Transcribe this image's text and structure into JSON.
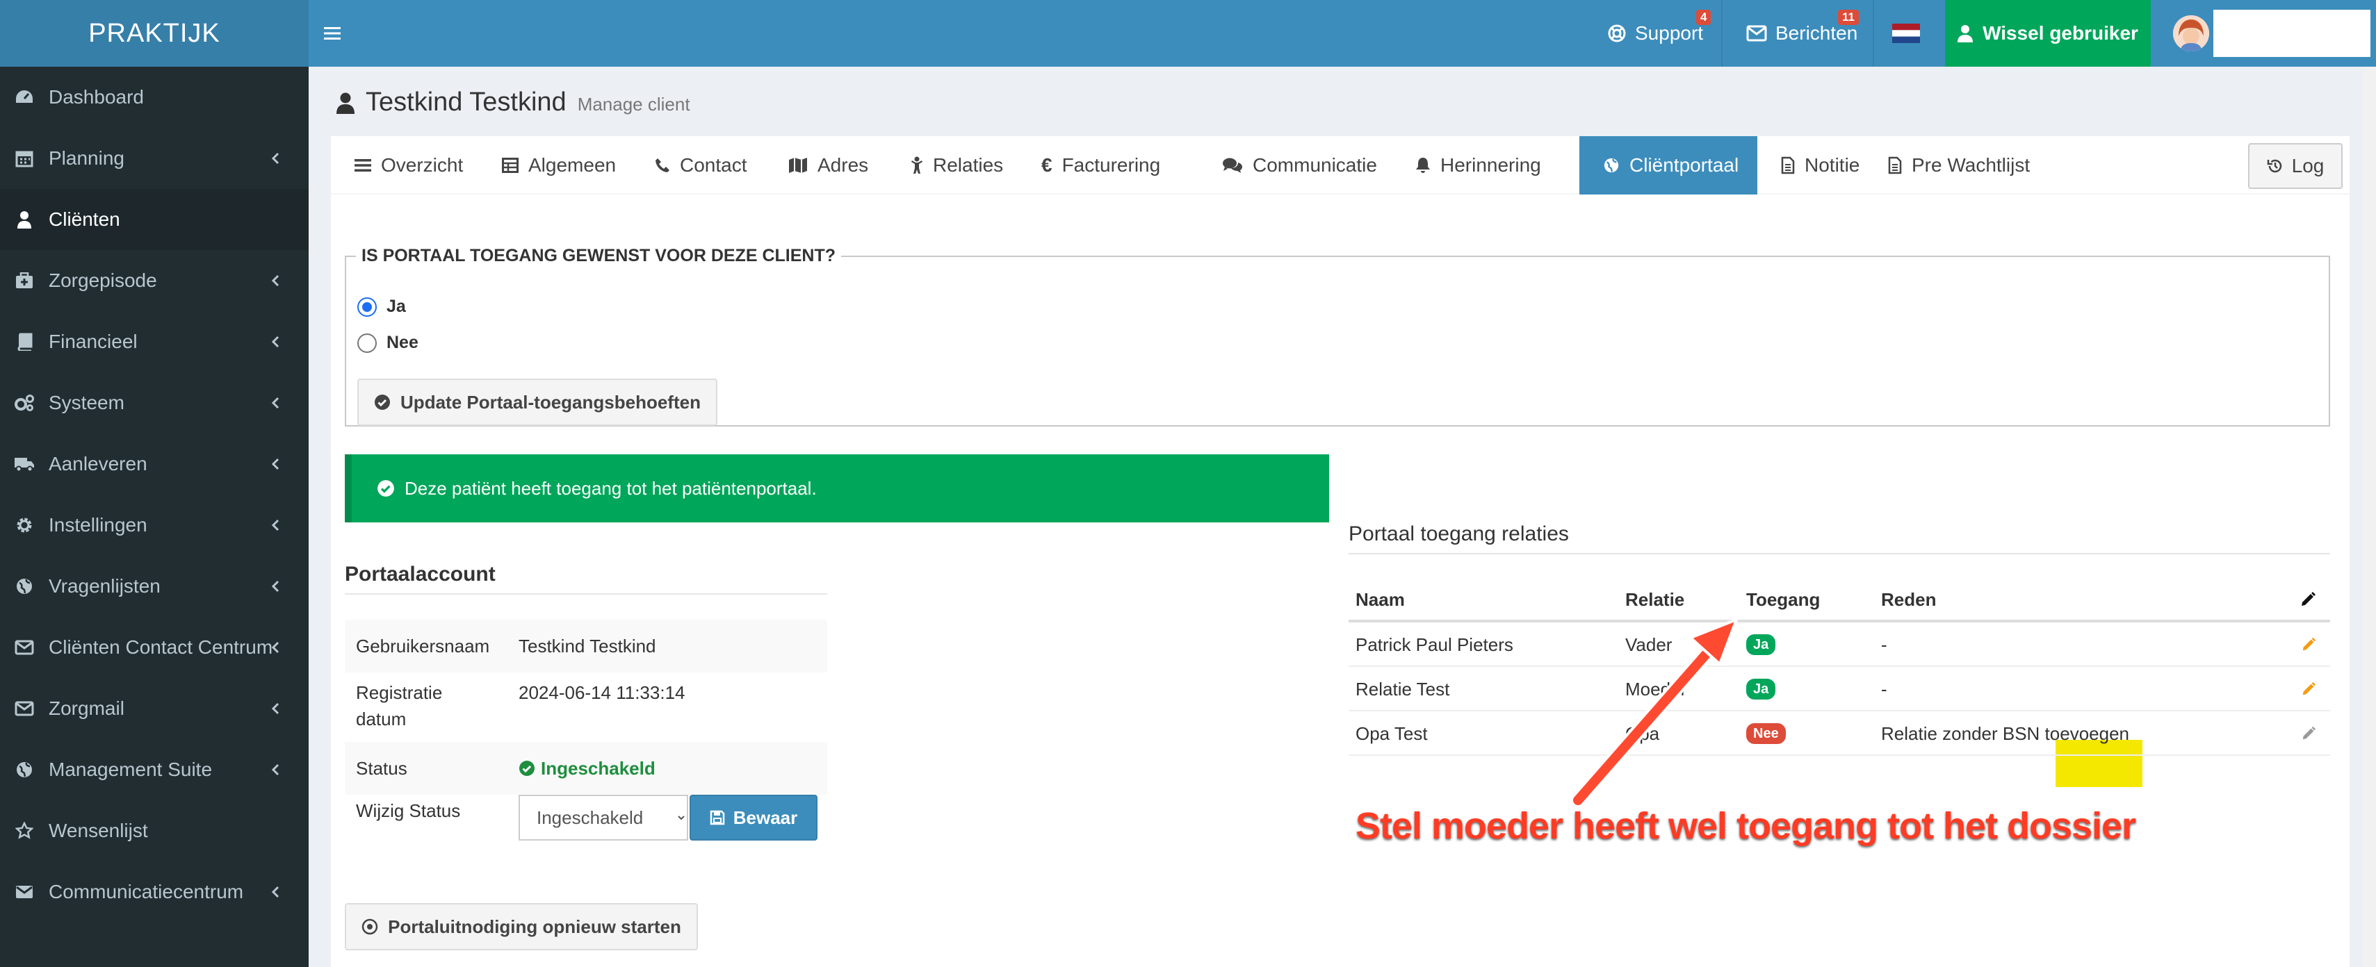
{
  "app": {
    "logo": "PRAKTIJK"
  },
  "topbar": {
    "support_label": "Support",
    "support_badge": "4",
    "messages_label": "Berichten",
    "messages_badge": "11",
    "switch_user_label": "Wissel gebruiker"
  },
  "sidebar": {
    "items": [
      {
        "label": "Dashboard",
        "icon": "dashboard-icon",
        "chevron": false
      },
      {
        "label": "Planning",
        "icon": "calendar-icon",
        "chevron": true
      },
      {
        "label": "Cliënten",
        "icon": "user-icon",
        "chevron": false,
        "active": true
      },
      {
        "label": "Zorgepisode",
        "icon": "medkit-icon",
        "chevron": true
      },
      {
        "label": "Financieel",
        "icon": "book-icon",
        "chevron": true
      },
      {
        "label": "Systeem",
        "icon": "cogs-icon",
        "chevron": true
      },
      {
        "label": "Aanleveren",
        "icon": "truck-icon",
        "chevron": true
      },
      {
        "label": "Instellingen",
        "icon": "gear-icon",
        "chevron": true
      },
      {
        "label": "Vragenlijsten",
        "icon": "globe-icon",
        "chevron": true
      },
      {
        "label": "Cliënten Contact Centrum",
        "icon": "envelope-icon",
        "chevron": true
      },
      {
        "label": "Zorgmail",
        "icon": "envelope-icon",
        "chevron": true
      },
      {
        "label": "Management Suite",
        "icon": "globe-icon",
        "chevron": true
      },
      {
        "label": "Wensenlijst",
        "icon": "star-icon",
        "chevron": false
      },
      {
        "label": "Communicatiecentrum",
        "icon": "envelope-icon",
        "chevron": true
      }
    ]
  },
  "page": {
    "title": "Testkind Testkind",
    "subtitle": "Manage client"
  },
  "tabs": [
    {
      "label": "Overzicht",
      "icon": "list-icon"
    },
    {
      "label": "Algemeen",
      "icon": "table-icon"
    },
    {
      "label": "Contact",
      "icon": "phone-icon"
    },
    {
      "label": "Adres",
      "icon": "map-icon"
    },
    {
      "label": "Relaties",
      "icon": "child-icon"
    },
    {
      "label": "Facturering",
      "icon": "euro-icon"
    },
    {
      "label": "Communicatie",
      "icon": "comments-icon"
    },
    {
      "label": "Herinnering",
      "icon": "bell-icon"
    },
    {
      "label": "Cliëntportaal",
      "icon": "globe-icon",
      "active": true
    },
    {
      "label": "Notitie",
      "icon": "file-icon"
    },
    {
      "label": "Pre Wachtlijst",
      "icon": "file-icon"
    }
  ],
  "log_button": "Log",
  "portal_question": {
    "legend": "IS PORTAAL TOEGANG GEWENST VOOR DEZE CLIENT?",
    "option_yes": "Ja",
    "option_no": "Nee",
    "selected": "Ja",
    "update_button": "Update Portaal-toegangsbehoeften"
  },
  "alert": {
    "text": "Deze patiënt heeft toegang tot het patiëntenportaal."
  },
  "account": {
    "title": "Portaalaccount",
    "username_label": "Gebruikersnaam",
    "username_value": "Testkind Testkind",
    "registration_label_1": "Registratie",
    "registration_label_2": "datum",
    "registration_value": "2024-06-14 11:33:14",
    "status_label": "Status",
    "status_value": "Ingeschakeld",
    "change_status_label": "Wijzig Status",
    "status_selected": "Ingeschakeld",
    "save_button": "Bewaar",
    "restart_button": "Portaluitnodiging opnieuw starten"
  },
  "relations": {
    "title": "Portaal toegang relaties",
    "headers": {
      "name": "Naam",
      "relation": "Relatie",
      "access": "Toegang",
      "reason": "Reden"
    },
    "rows": [
      {
        "name": "Patrick Paul Pieters",
        "relation": "Vader",
        "access": "Ja",
        "reason": "-"
      },
      {
        "name": "Relatie Test",
        "relation": "Moeder",
        "access": "Ja",
        "reason": "-"
      },
      {
        "name": "Opa Test",
        "relation": "Opa",
        "access": "Nee",
        "reason": "Relatie zonder BSN toevoegen"
      }
    ]
  },
  "annotation": {
    "text": "Stel moeder heeft wel toegang tot het dossier"
  },
  "colors": {
    "primary": "#3c8dbc",
    "success": "#00a65a",
    "danger": "#dd4b39",
    "sidebar": "#222d32",
    "annotation": "#ff3b24",
    "highlight": "#f5e800",
    "edit_icon": "#f39c12"
  }
}
